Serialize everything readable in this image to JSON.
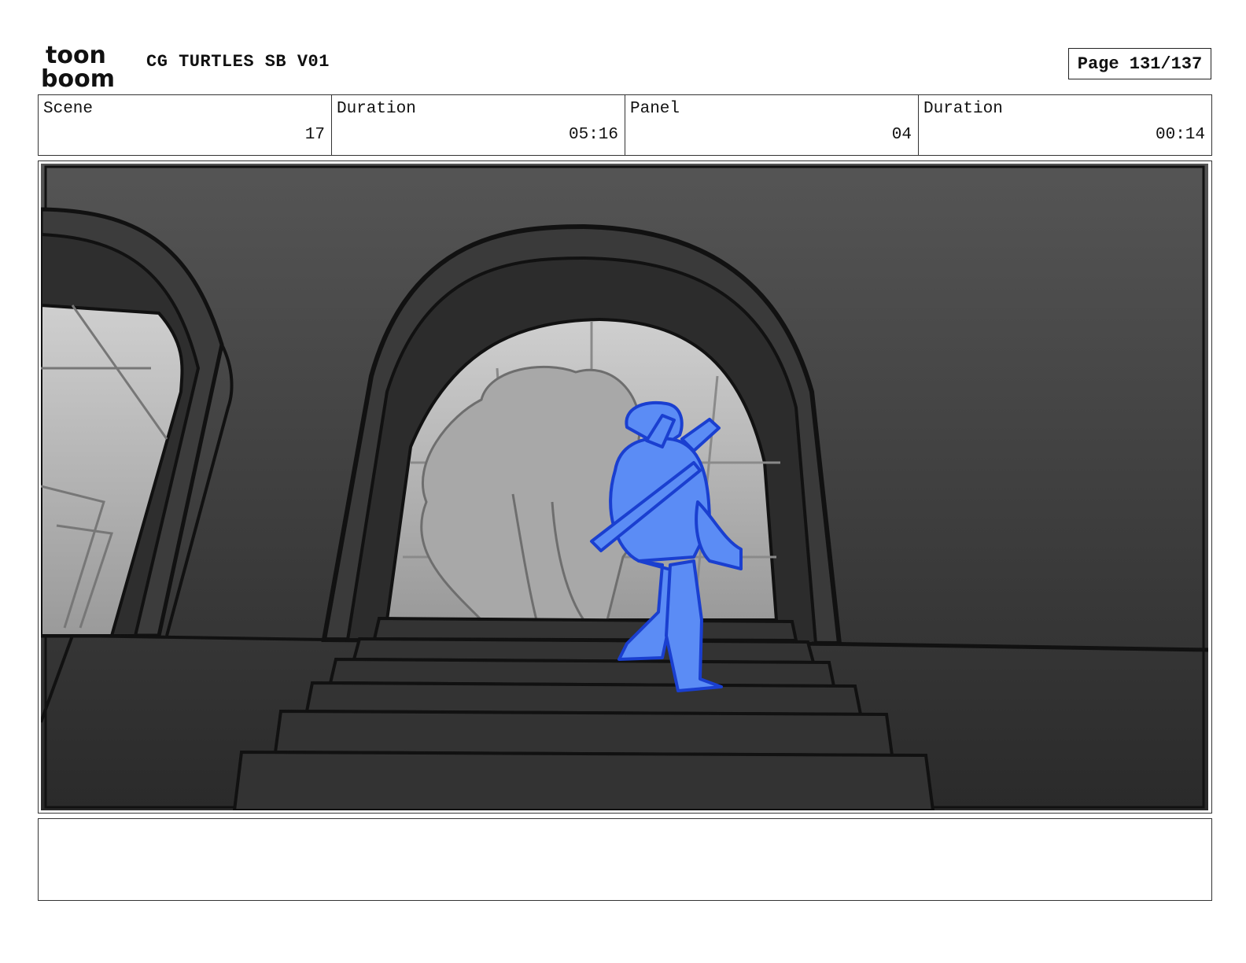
{
  "header": {
    "logo_top": "toon",
    "logo_bottom": "boom",
    "project_title": "CG TURTLES SB V01",
    "page_label": "Page 131/137"
  },
  "info": {
    "scene_label": "Scene",
    "scene_value": "17",
    "scene_duration_label": "Duration",
    "scene_duration_value": "05:16",
    "panel_label": "Panel",
    "panel_value": "04",
    "panel_duration_label": "Duration",
    "panel_duration_value": "00:14"
  },
  "panel": {
    "description": "",
    "colors": {
      "wall_top": "#555555",
      "wall_bottom": "#2c2c2c",
      "sky": "#b8b8b8",
      "character": "#5b8cf5",
      "character_line": "#1a3fd0"
    }
  },
  "notes": {
    "text": ""
  }
}
